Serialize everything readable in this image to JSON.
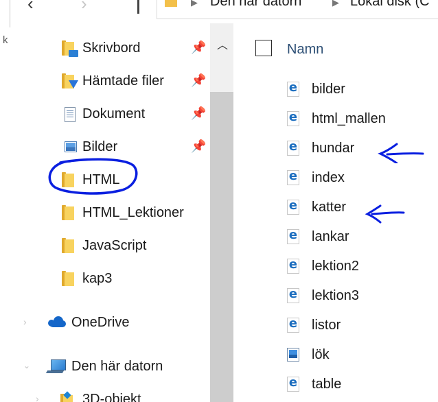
{
  "address_bar": {
    "segments": [
      "Den här datorn",
      "Lokal disk (C"
    ]
  },
  "left_edge": {
    "char": "k"
  },
  "nav_pane": {
    "quick_access": [
      {
        "label": "Skrivbord",
        "icon": "desktop-folder-icon",
        "pinned": true
      },
      {
        "label": "Hämtade filer",
        "icon": "downloads-folder-icon",
        "pinned": true
      },
      {
        "label": "Dokument",
        "icon": "documents-icon",
        "pinned": true
      },
      {
        "label": "Bilder",
        "icon": "pictures-icon",
        "pinned": true
      },
      {
        "label": "HTML",
        "icon": "folder-icon",
        "pinned": false,
        "circled": true
      },
      {
        "label": "HTML_Lektioner",
        "icon": "folder-icon",
        "pinned": false
      },
      {
        "label": "JavaScript",
        "icon": "folder-icon",
        "pinned": false
      },
      {
        "label": "kap3",
        "icon": "folder-icon",
        "pinned": false
      }
    ],
    "onedrive": {
      "label": "OneDrive",
      "icon": "onedrive-cloud-icon"
    },
    "this_pc": {
      "label": "Den här datorn",
      "icon": "computer-icon"
    },
    "objects_3d": {
      "label": "3D-objekt",
      "icon": "3d-objects-folder-icon"
    }
  },
  "content": {
    "column_header": "Namn",
    "files": [
      {
        "name": "bilder",
        "icon": "html-file-icon"
      },
      {
        "name": "html_mallen",
        "icon": "html-file-icon"
      },
      {
        "name": "hundar",
        "icon": "html-file-icon",
        "annotated": true
      },
      {
        "name": "index",
        "icon": "html-file-icon"
      },
      {
        "name": "katter",
        "icon": "html-file-icon",
        "annotated": true
      },
      {
        "name": "lankar",
        "icon": "html-file-icon"
      },
      {
        "name": "lektion2",
        "icon": "html-file-icon"
      },
      {
        "name": "lektion3",
        "icon": "html-file-icon"
      },
      {
        "name": "listor",
        "icon": "html-file-icon"
      },
      {
        "name": "lök",
        "icon": "image-file-icon"
      },
      {
        "name": "table",
        "icon": "html-file-icon"
      }
    ]
  },
  "colors": {
    "folder": "#f8d35f",
    "folder_dark": "#e0a92d",
    "ie_blue": "#1b6dbf",
    "annotation_blue": "#0a1fe0",
    "header_text": "#2d4f75"
  }
}
